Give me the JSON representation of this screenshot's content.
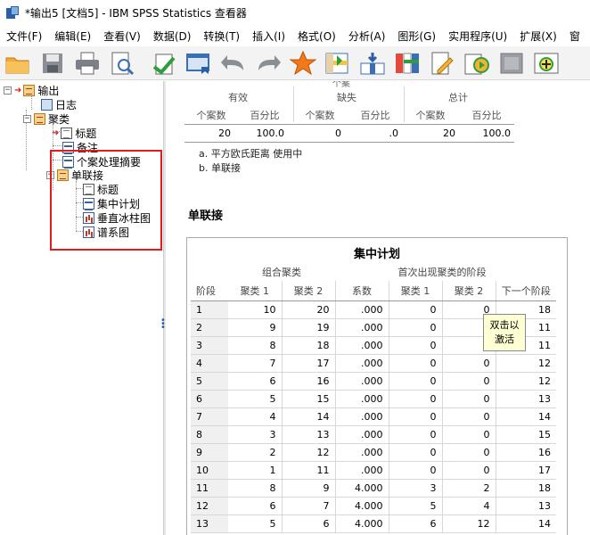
{
  "window": {
    "title": "*输出5 [文档5] - IBM SPSS Statistics 查看器"
  },
  "menu": [
    "文件(F)",
    "编辑(E)",
    "查看(V)",
    "数据(D)",
    "转换(T)",
    "插入(I)",
    "格式(O)",
    "分析(A)",
    "图形(G)",
    "实用程序(U)",
    "扩展(X)",
    "窗"
  ],
  "toolbar": [
    "open-icon",
    "save-icon",
    "print-icon",
    "print-preview-icon",
    "export-icon",
    "recall-dialog-icon",
    "undo-icon",
    "redo-icon",
    "goto-data-icon",
    "goto-case-icon",
    "goto-variable-icon",
    "variables-icon",
    "create-title-icon",
    "designate-window-icon",
    "show-all-icon",
    "insert-output-icon"
  ],
  "tree": {
    "output": "输出",
    "log": "日志",
    "cluster": "聚类",
    "cluster_title": "标题",
    "notes": "备注",
    "case_summary": "个案处理摘要",
    "single_linkage": "单联接",
    "sl_title": "标题",
    "agglomeration": "集中计划",
    "icicle": "垂直冰柱图",
    "dendrogram": "谱系图"
  },
  "case_summary": {
    "cut_title": "个案",
    "groups": [
      "有效",
      "缺失",
      "总计"
    ],
    "subheaders": [
      "个案数",
      "百分比",
      "个案数",
      "百分比",
      "个案数",
      "百分比"
    ],
    "values": [
      "20",
      "100.0",
      "0",
      ".0",
      "20",
      "100.0"
    ],
    "notes": [
      "a. 平方欧氏距离 使用中",
      "b. 单联接"
    ]
  },
  "section_title": "单联接",
  "schedule": {
    "title": "集中计划",
    "group_combined": "组合聚类",
    "group_first": "首次出现聚类的阶段",
    "headers": [
      "阶段",
      "聚类 1",
      "聚类 2",
      "系数",
      "聚类 1",
      "聚类 2",
      "下一个阶段"
    ],
    "rows": [
      [
        "1",
        "10",
        "20",
        ".000",
        "0",
        "0",
        "18"
      ],
      [
        "2",
        "9",
        "19",
        ".000",
        "0",
        "",
        "11"
      ],
      [
        "3",
        "8",
        "18",
        ".000",
        "0",
        "",
        "11"
      ],
      [
        "4",
        "7",
        "17",
        ".000",
        "0",
        "0",
        "12"
      ],
      [
        "5",
        "6",
        "16",
        ".000",
        "0",
        "0",
        "12"
      ],
      [
        "6",
        "5",
        "15",
        ".000",
        "0",
        "0",
        "13"
      ],
      [
        "7",
        "4",
        "14",
        ".000",
        "0",
        "0",
        "14"
      ],
      [
        "8",
        "3",
        "13",
        ".000",
        "0",
        "0",
        "15"
      ],
      [
        "9",
        "2",
        "12",
        ".000",
        "0",
        "0",
        "16"
      ],
      [
        "10",
        "1",
        "11",
        ".000",
        "0",
        "0",
        "17"
      ],
      [
        "11",
        "8",
        "9",
        "4.000",
        "3",
        "2",
        "18"
      ],
      [
        "12",
        "6",
        "7",
        "4.000",
        "5",
        "4",
        "13"
      ],
      [
        "13",
        "5",
        "6",
        "4.000",
        "6",
        "12",
        "14"
      ]
    ]
  },
  "tooltip": {
    "line1": "双击以",
    "line2": "激活"
  }
}
